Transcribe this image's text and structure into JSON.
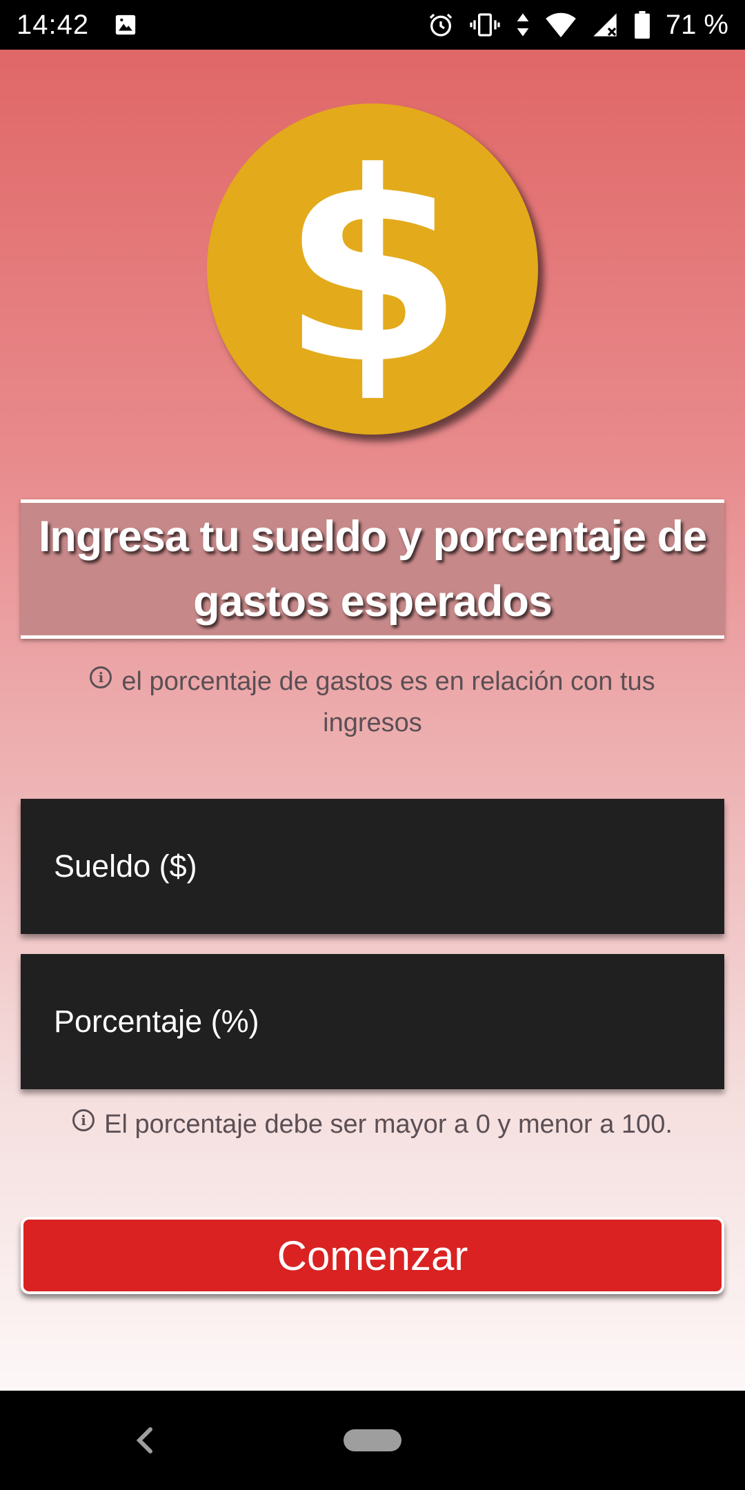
{
  "status_bar": {
    "time": "14:42",
    "battery": "71 %",
    "icons": [
      "image-icon",
      "alarm-icon",
      "vibrate-icon",
      "data-arrows-icon",
      "wifi-icon",
      "signal-icon",
      "battery-icon"
    ]
  },
  "coin": {
    "symbol": "$",
    "color": "#e3aa1b"
  },
  "title": "Ingresa tu sueldo y porcentaje de gastos esperados",
  "hint_top": "el porcentaje de gastos es en relación con tus ingresos",
  "inputs": {
    "salary_placeholder": "Sueldo ($)",
    "salary_value": "",
    "percent_placeholder": "Porcentaje (%)",
    "percent_value": ""
  },
  "hint_bottom": "El porcentaje debe ser mayor a 0 y menor a 100.",
  "button": {
    "label": "Comenzar",
    "color": "#da2222"
  },
  "nav": {
    "icons": [
      "back-icon",
      "home-pill-icon"
    ]
  }
}
